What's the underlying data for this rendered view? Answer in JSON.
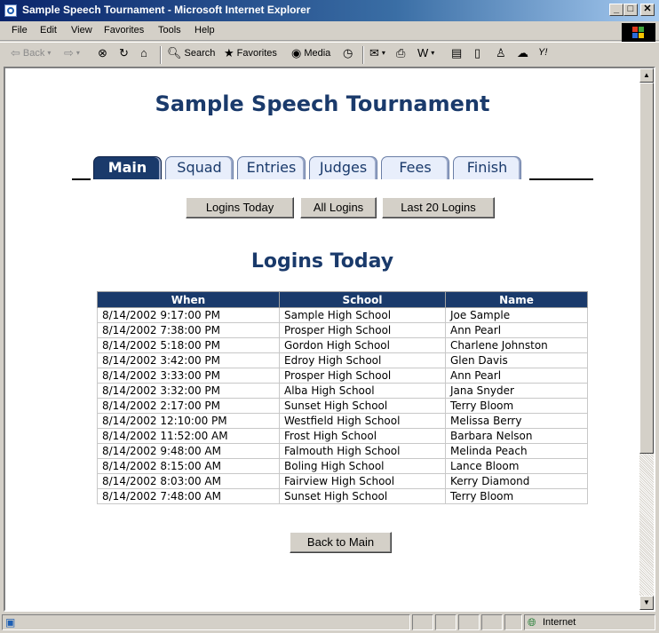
{
  "window": {
    "title": "Sample Speech Tournament - Microsoft Internet Explorer",
    "controls": {
      "minimize": "_",
      "maximize": "□",
      "close": "✕"
    }
  },
  "menu": [
    "File",
    "Edit",
    "View",
    "Favorites",
    "Tools",
    "Help"
  ],
  "toolbar": {
    "back": "Back",
    "search": "Search",
    "favorites": "Favorites",
    "media": "Media"
  },
  "page": {
    "title": "Sample Speech Tournament",
    "tabs": [
      "Main",
      "Squad",
      "Entries",
      "Judges",
      "Fees",
      "Finish"
    ],
    "active_tab": "Main",
    "sub_buttons": [
      "Logins Today",
      "All Logins",
      "Last 20 Logins"
    ],
    "section_title": "Logins Today",
    "table": {
      "headers": [
        "When",
        "School",
        "Name"
      ],
      "rows": [
        [
          "8/14/2002 9:17:00 PM",
          "Sample High School",
          "Joe Sample"
        ],
        [
          "8/14/2002 7:38:00 PM",
          "Prosper High School",
          "Ann Pearl"
        ],
        [
          "8/14/2002 5:18:00 PM",
          "Gordon High School",
          "Charlene Johnston"
        ],
        [
          "8/14/2002 3:42:00 PM",
          "Edroy High School",
          "Glen Davis"
        ],
        [
          "8/14/2002 3:33:00 PM",
          "Prosper High School",
          "Ann Pearl"
        ],
        [
          "8/14/2002 3:32:00 PM",
          "Alba High School",
          "Jana Snyder"
        ],
        [
          "8/14/2002 2:17:00 PM",
          "Sunset High School",
          "Terry Bloom"
        ],
        [
          "8/14/2002 12:10:00 PM",
          "Westfield High School",
          "Melissa Berry"
        ],
        [
          "8/14/2002 11:52:00 AM",
          "Frost High School",
          "Barbara Nelson"
        ],
        [
          "8/14/2002 9:48:00 AM",
          "Falmouth High School",
          "Melinda Peach"
        ],
        [
          "8/14/2002 8:15:00 AM",
          "Boling High School",
          "Lance Bloom"
        ],
        [
          "8/14/2002 8:03:00 AM",
          "Fairview High School",
          "Kerry Diamond"
        ],
        [
          "8/14/2002 7:48:00 AM",
          "Sunset High School",
          "Terry Bloom"
        ]
      ]
    },
    "back_button": "Back to Main"
  },
  "status": {
    "zone": "Internet"
  },
  "colors": {
    "accent": "#1a3a6b",
    "titlebar": "#0a246a"
  }
}
